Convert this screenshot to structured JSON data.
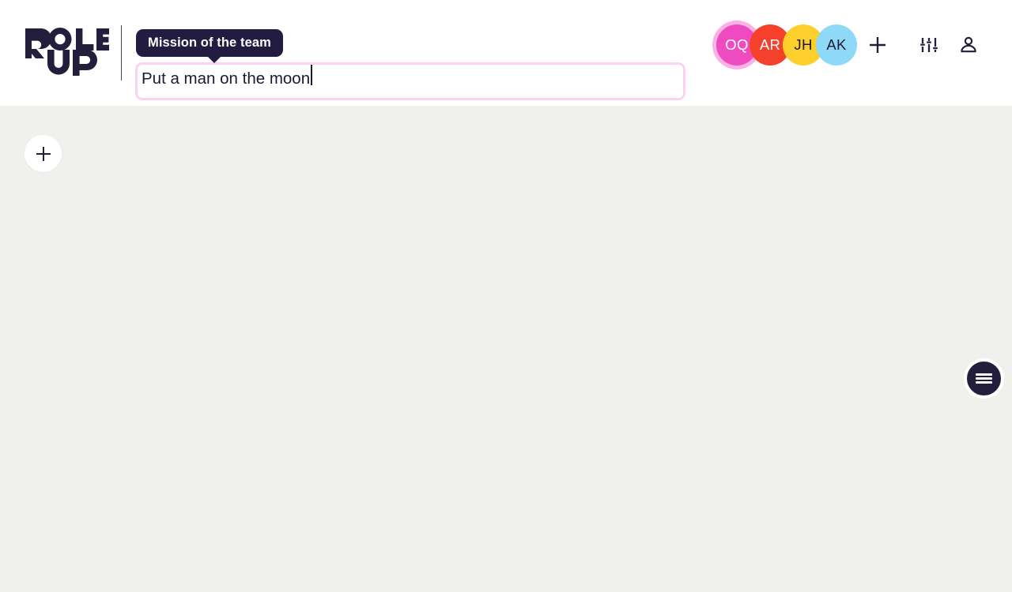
{
  "app": {
    "name": "Role Up",
    "logo_text_line1": "ROLE",
    "logo_text_line2": "UP"
  },
  "header": {
    "tooltip_label": "Mission of the team",
    "mission_input": {
      "value": "Put a man on the moon",
      "placeholder": "Mission of the team"
    },
    "divider": "vertical-divider",
    "avatars": [
      {
        "initials": "OQ",
        "bg": "#ef4bc0",
        "text_color": "#ffffff",
        "ring": "#fbb3e6",
        "selected": true
      },
      {
        "initials": "AR",
        "bg": "#f5402c",
        "text_color": "#ffffff",
        "ring": "",
        "selected": false
      },
      {
        "initials": "JH",
        "bg": "#fccf2c",
        "text_color": "#1d1833",
        "ring": "",
        "selected": false
      },
      {
        "initials": "AK",
        "bg": "#8ed8f8",
        "text_color": "#1d1833",
        "ring": "",
        "selected": false
      }
    ],
    "actions": [
      {
        "icon": "plus-icon",
        "label": "Add member"
      },
      {
        "icon": "tune-icon",
        "label": "Settings"
      },
      {
        "icon": "person-icon",
        "label": "Account"
      }
    ]
  },
  "canvas": {
    "background_color": "#f0f0ec",
    "add_button": {
      "icon": "plus-icon",
      "label": "Add"
    },
    "menu_button": {
      "icon": "hamburger-menu-icon",
      "label": "Menu"
    }
  },
  "colors": {
    "brand_dark": "#241e3d",
    "accent_pink": "#fbd3f0",
    "canvas_bg": "#f0f0ec",
    "header_bg": "#ffffff"
  }
}
